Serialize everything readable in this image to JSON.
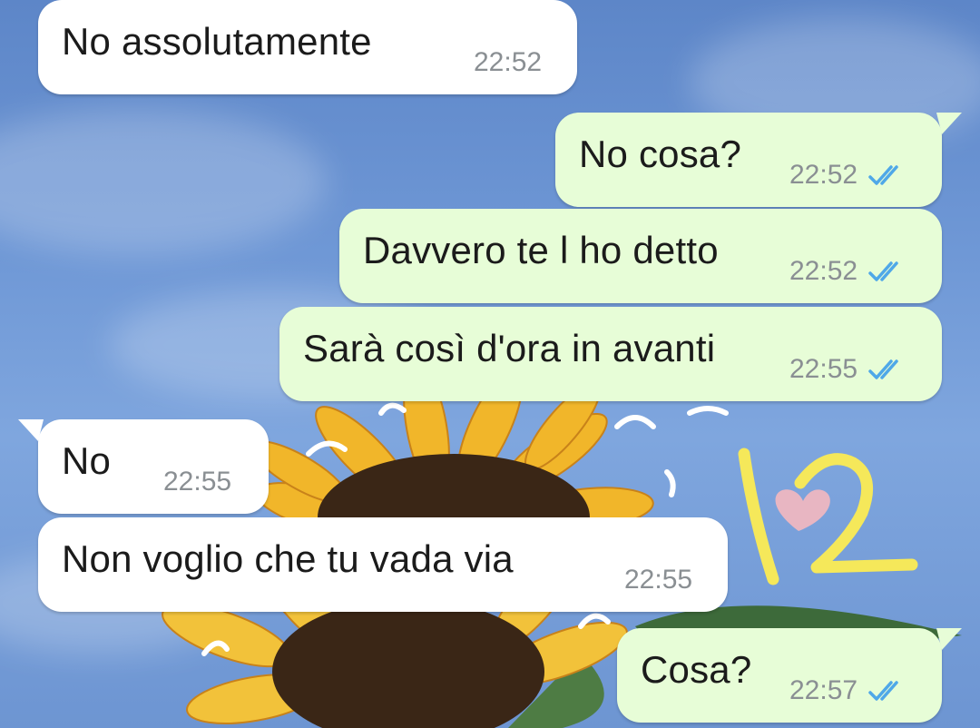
{
  "colors": {
    "incoming_bubble": "#ffffff",
    "outgoing_bubble": "#e7fdd7",
    "read_ticks": "#4fa8e8",
    "annotation": "#f5e85a",
    "heart": "#f4b8bf"
  },
  "annotation": {
    "number": "12"
  },
  "messages": [
    {
      "direction": "incoming",
      "text": "No assolutamente",
      "time": "22:52"
    },
    {
      "direction": "outgoing",
      "text": "No cosa?",
      "time": "22:52",
      "status": "read"
    },
    {
      "direction": "outgoing",
      "text": "Davvero te l ho detto",
      "time": "22:52",
      "status": "read"
    },
    {
      "direction": "outgoing",
      "text": "Sarà così d'ora in avanti",
      "time": "22:55",
      "status": "read"
    },
    {
      "direction": "incoming",
      "text": "No",
      "time": "22:55"
    },
    {
      "direction": "incoming",
      "text": "Non voglio che tu vada via",
      "time": "22:55"
    },
    {
      "direction": "outgoing",
      "text": "Cosa?",
      "time": "22:57",
      "status": "read"
    }
  ]
}
